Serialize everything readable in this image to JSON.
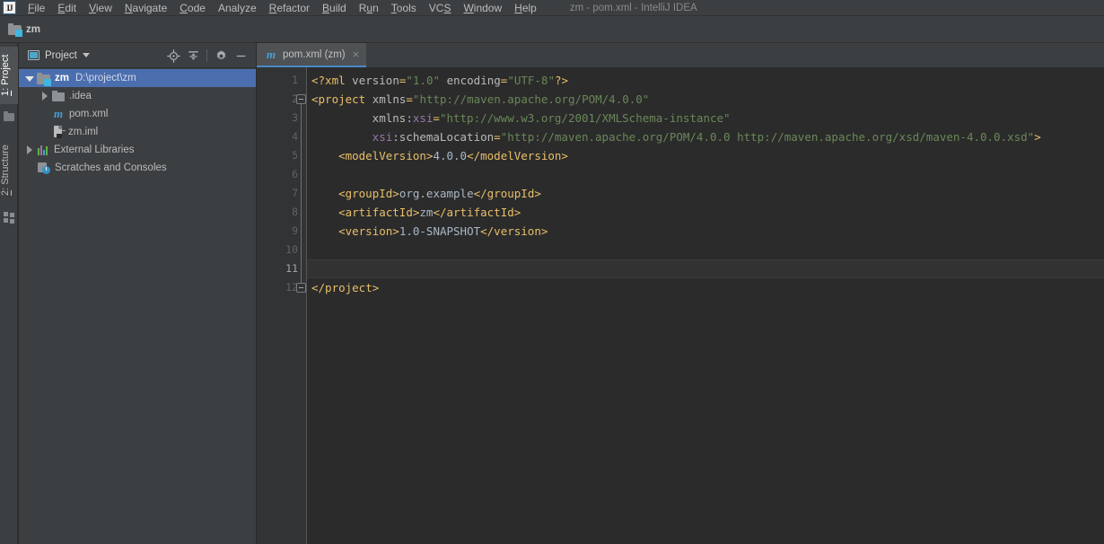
{
  "window": {
    "title": "zm - pom.xml - IntelliJ IDEA",
    "logo": "IJ"
  },
  "menubar": {
    "items": [
      {
        "label": "File",
        "mnemonic": "F"
      },
      {
        "label": "Edit",
        "mnemonic": "E"
      },
      {
        "label": "View",
        "mnemonic": "V"
      },
      {
        "label": "Navigate",
        "mnemonic": "N"
      },
      {
        "label": "Code",
        "mnemonic": "C"
      },
      {
        "label": "Analyze",
        "mnemonic": ""
      },
      {
        "label": "Refactor",
        "mnemonic": "R"
      },
      {
        "label": "Build",
        "mnemonic": "B"
      },
      {
        "label": "Run",
        "mnemonic": "u"
      },
      {
        "label": "Tools",
        "mnemonic": "T"
      },
      {
        "label": "VCS",
        "mnemonic": "S"
      },
      {
        "label": "Window",
        "mnemonic": "W"
      },
      {
        "label": "Help",
        "mnemonic": "H"
      }
    ]
  },
  "navbar": {
    "crumb": "zm",
    "icon": "folder-module-icon"
  },
  "toolstrip": {
    "tabs": [
      {
        "label": "1: Project",
        "active": true
      },
      {
        "label": "2: Structure",
        "active": false
      }
    ],
    "icons": [
      "folder-icon",
      "grid-icon"
    ]
  },
  "project_panel": {
    "title": "Project",
    "window_icon": "project-window-icon",
    "dropdown_icon": "chevron-down-icon",
    "tools": [
      {
        "name": "locate-target-icon",
        "title": "Select Opened File"
      },
      {
        "name": "collapse-all-icon",
        "title": "Collapse All"
      },
      {
        "name": "gear-icon",
        "title": "Settings"
      },
      {
        "name": "minimize-icon",
        "title": "Hide"
      }
    ],
    "tree": [
      {
        "label": "zm",
        "path": "D:\\project\\zm",
        "icon": "folder-module-icon",
        "twisty": "expanded",
        "indent": 0,
        "selected": true
      },
      {
        "label": ".idea",
        "path": "",
        "icon": "folder-icon",
        "twisty": "collapsed",
        "indent": 1,
        "selected": false
      },
      {
        "label": "pom.xml",
        "path": "",
        "icon": "maven-icon",
        "twisty": "none",
        "indent": 1,
        "selected": false
      },
      {
        "label": "zm.iml",
        "path": "",
        "icon": "iml-file-icon",
        "twisty": "none",
        "indent": 1,
        "selected": false
      },
      {
        "label": "External Libraries",
        "path": "",
        "icon": "libraries-icon",
        "twisty": "collapsed",
        "indent": 0,
        "selected": false
      },
      {
        "label": "Scratches and Consoles",
        "path": "",
        "icon": "scratches-icon",
        "twisty": "none",
        "indent": 0,
        "selected": false
      }
    ]
  },
  "editor": {
    "tabs": [
      {
        "label": "pom.xml (zm)",
        "icon": "maven-icon",
        "close": "×",
        "active": true
      }
    ],
    "current_line": 11,
    "lines": [
      {
        "n": 1,
        "indent": 0,
        "fold": "none",
        "tokens": [
          {
            "t": "<?xml",
            "c": "tag"
          },
          {
            "t": " ",
            "c": "punct"
          },
          {
            "t": "version",
            "c": "attr"
          },
          {
            "t": "=",
            "c": "tag"
          },
          {
            "t": "\"1.0\"",
            "c": "val"
          },
          {
            "t": " ",
            "c": "punct"
          },
          {
            "t": "encoding",
            "c": "attr"
          },
          {
            "t": "=",
            "c": "tag"
          },
          {
            "t": "\"UTF-8\"",
            "c": "val"
          },
          {
            "t": "?>",
            "c": "tag"
          }
        ]
      },
      {
        "n": 2,
        "indent": 0,
        "fold": "start",
        "tokens": [
          {
            "t": "<project",
            "c": "tag"
          },
          {
            "t": " ",
            "c": "punct"
          },
          {
            "t": "xmlns",
            "c": "attr"
          },
          {
            "t": "=",
            "c": "tag"
          },
          {
            "t": "\"http://maven.apache.org/POM/4.0.0\"",
            "c": "val"
          }
        ]
      },
      {
        "n": 3,
        "indent": 9,
        "fold": "none",
        "tokens": [
          {
            "t": "xmlns",
            "c": "attr"
          },
          {
            "t": ":",
            "c": "punct"
          },
          {
            "t": "xsi",
            "c": "ns"
          },
          {
            "t": "=",
            "c": "tag"
          },
          {
            "t": "\"http://www.w3.org/2001/XMLSchema-instance\"",
            "c": "val"
          }
        ]
      },
      {
        "n": 4,
        "indent": 9,
        "fold": "none",
        "tokens": [
          {
            "t": "xsi",
            "c": "ns"
          },
          {
            "t": ":",
            "c": "punct"
          },
          {
            "t": "schemaLocation",
            "c": "attr"
          },
          {
            "t": "=",
            "c": "tag"
          },
          {
            "t": "\"http://maven.apache.org/POM/4.0.0 http://maven.apache.org/xsd/maven-4.0.0.xsd\"",
            "c": "val"
          },
          {
            "t": ">",
            "c": "tag"
          }
        ]
      },
      {
        "n": 5,
        "indent": 4,
        "fold": "none",
        "tokens": [
          {
            "t": "<modelVersion>",
            "c": "tag"
          },
          {
            "t": "4.0.0",
            "c": "text"
          },
          {
            "t": "</modelVersion>",
            "c": "tag"
          }
        ]
      },
      {
        "n": 6,
        "indent": 0,
        "fold": "none",
        "tokens": []
      },
      {
        "n": 7,
        "indent": 4,
        "fold": "none",
        "tokens": [
          {
            "t": "<groupId>",
            "c": "tag"
          },
          {
            "t": "org.example",
            "c": "text"
          },
          {
            "t": "</groupId>",
            "c": "tag"
          }
        ]
      },
      {
        "n": 8,
        "indent": 4,
        "fold": "none",
        "tokens": [
          {
            "t": "<artifactId>",
            "c": "tag"
          },
          {
            "t": "zm",
            "c": "text"
          },
          {
            "t": "</artifactId>",
            "c": "tag"
          }
        ]
      },
      {
        "n": 9,
        "indent": 4,
        "fold": "none",
        "tokens": [
          {
            "t": "<version>",
            "c": "tag"
          },
          {
            "t": "1.0-SNAPSHOT",
            "c": "text"
          },
          {
            "t": "</version>",
            "c": "tag"
          }
        ]
      },
      {
        "n": 10,
        "indent": 0,
        "fold": "none",
        "tokens": []
      },
      {
        "n": 11,
        "indent": 0,
        "fold": "none",
        "tokens": []
      },
      {
        "n": 12,
        "indent": 0,
        "fold": "end",
        "tokens": [
          {
            "t": "</project>",
            "c": "tag"
          }
        ]
      }
    ]
  },
  "colors": {
    "menubar_bg": "#3c3f41",
    "panel_bg": "#3c3f41",
    "editor_bg": "#2b2b2b",
    "gutter_bg": "#313335",
    "selection_blue": "#4b6eaf",
    "tab_active_underline": "#4a88c7",
    "tag": "#e8bf6a",
    "attr_value": "#6a8759",
    "namespace": "#9876aa",
    "text": "#a9b7c6"
  }
}
